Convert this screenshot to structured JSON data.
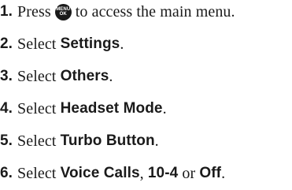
{
  "steps": [
    {
      "num": "1.",
      "before": "Press",
      "icon": {
        "name": "menu-ok-key",
        "line1": "MENU",
        "line2": "OK"
      },
      "after": "to access the main menu."
    },
    {
      "num": "2.",
      "text": "Select ",
      "bold": "Settings",
      "end": "."
    },
    {
      "num": "3.",
      "text": "Select ",
      "bold": "Others",
      "end": "."
    },
    {
      "num": "4.",
      "text": "Select ",
      "bold": "Headset Mode",
      "end": "."
    },
    {
      "num": "5.",
      "text": "Select ",
      "bold": "Turbo Button",
      "end": "."
    },
    {
      "num": "6.",
      "text": "Select ",
      "bold": "Voice Calls",
      "sep1": ", ",
      "bold2": "10-4",
      "sep2": " or ",
      "bold3": "Off",
      "end": "."
    }
  ]
}
